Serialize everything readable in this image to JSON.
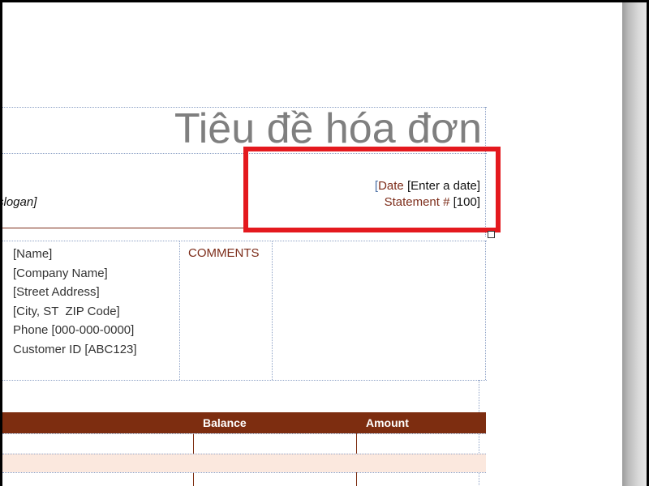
{
  "invoice": {
    "title": "Tiêu đề hóa đơn",
    "slogan": "slogan]",
    "date_label": "Date",
    "date_value": "[Enter a date]",
    "statement_label": "Statement #",
    "statement_value": "[100]"
  },
  "customer": {
    "lines": [
      "[Name]",
      "[Company Name]",
      "[Street Address]",
      "[City, ST  ZIP Code]",
      "Phone [000-000-0000]",
      "Customer ID [ABC123]"
    ]
  },
  "comments": {
    "label": "COMMENTS"
  },
  "table": {
    "headers": [
      "Balance",
      "Amount"
    ]
  },
  "colors": {
    "accent": "#7d2d10",
    "highlight": "#e4191e",
    "row_tint": "#fbe8de"
  }
}
